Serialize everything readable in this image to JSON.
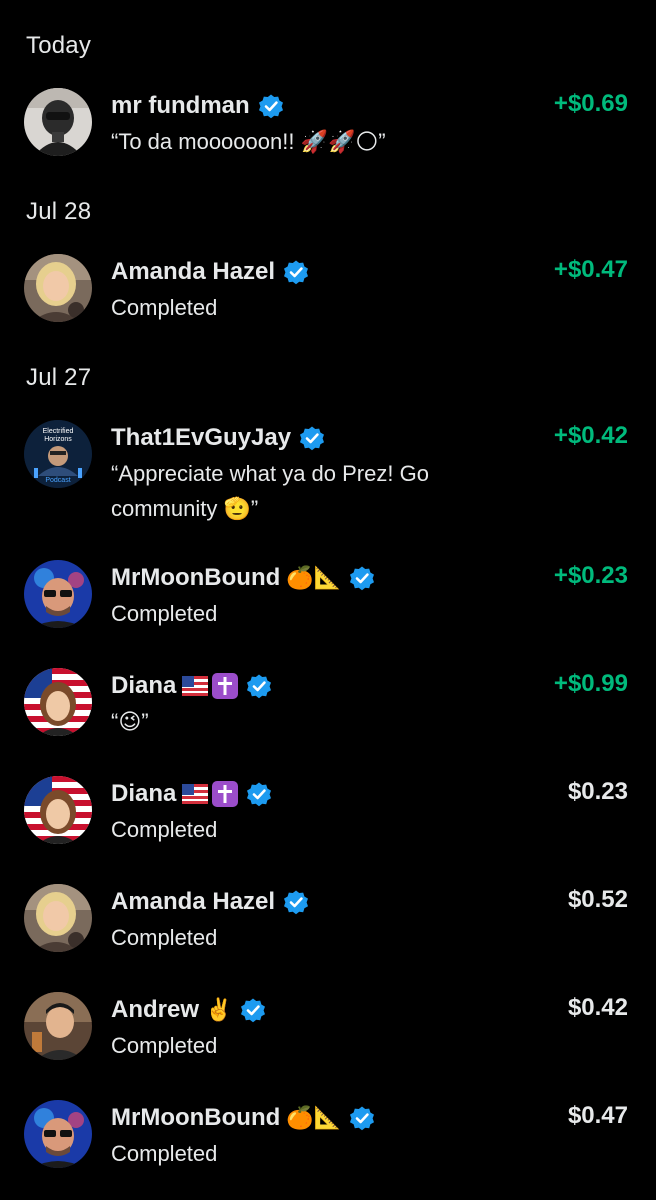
{
  "colors": {
    "background": "#000000",
    "text": "#e7e9ea",
    "positive": "#00ba7c",
    "verified": "#1d9bf0"
  },
  "sections": [
    {
      "label": "Today"
    },
    {
      "label": "Jul 28"
    },
    {
      "label": "Jul 27"
    }
  ],
  "transactions": [
    {
      "name": "mr fundman",
      "note": "“To da moooooon!! 🚀🚀🌕”",
      "amount": "+$0.69",
      "icon": "rocket-moon-emoji"
    },
    {
      "name": "Amanda Hazel",
      "note": "Completed",
      "amount": "+$0.47"
    },
    {
      "name": "That1EvGuyJay",
      "note_line1": "“Appreciate what ya do Prez! Go",
      "note_line2": "community 🫡”",
      "amount": "+$0.42"
    },
    {
      "name": "MrMoonBound",
      "name_emoji": "🍊📐",
      "note": "Completed",
      "amount": "+$0.23"
    },
    {
      "name": "Diana",
      "note": "“😉”",
      "amount": "+$0.99"
    },
    {
      "name": "Diana",
      "note": "Completed",
      "amount": "$0.23"
    },
    {
      "name": "Amanda Hazel",
      "note": "Completed",
      "amount": "$0.52"
    },
    {
      "name": "Andrew",
      "name_emoji": "✌️",
      "note": "Completed",
      "amount": "$0.42"
    },
    {
      "name": "MrMoonBound",
      "name_emoji": "🍊📐",
      "note": "Completed",
      "amount": "$0.47"
    }
  ],
  "avatar_badge_text": {
    "line1": "Electrified",
    "line2": "Horizons",
    "line3": "Podcast"
  }
}
